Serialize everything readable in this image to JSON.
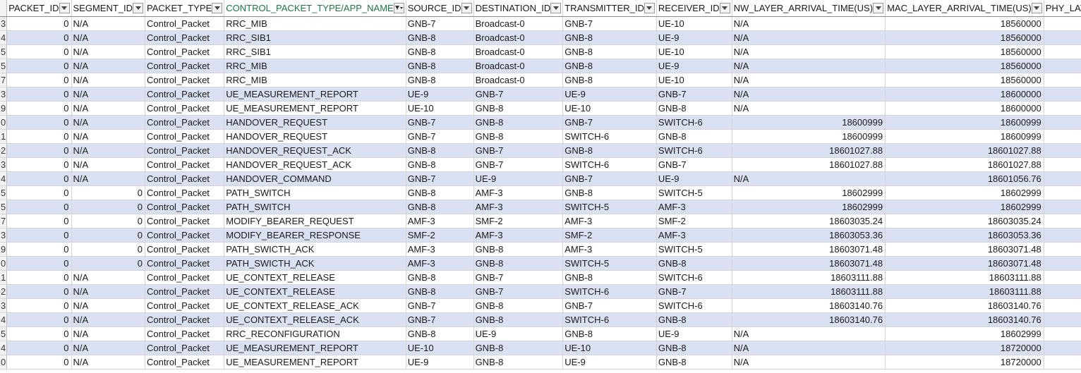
{
  "columns": [
    {
      "key": "PACKET_ID",
      "label": "PACKET_ID",
      "filtered": false
    },
    {
      "key": "SEGMENT_ID",
      "label": "SEGMENT_ID",
      "filtered": false
    },
    {
      "key": "PACKET_TYPE",
      "label": "PACKET_TYPE",
      "filtered": false
    },
    {
      "key": "CONTROL_PACKET_TYPE",
      "label": "CONTROL_PACKET_TYPE/APP_NAME",
      "filtered": true
    },
    {
      "key": "SOURCE_ID",
      "label": "SOURCE_ID",
      "filtered": false
    },
    {
      "key": "DESTINATION_ID",
      "label": "DESTINATION_ID",
      "filtered": false
    },
    {
      "key": "TRANSMITTER_ID",
      "label": "TRANSMITTER_ID",
      "filtered": false
    },
    {
      "key": "RECEIVER_ID",
      "label": "RECEIVER_ID",
      "filtered": false
    },
    {
      "key": "NW_LAYER_ARRIVAL",
      "label": "NW_LAYER_ARRIVAL_TIME(US)",
      "filtered": false
    },
    {
      "key": "MAC_LAYER_ARRIVAL",
      "label": "MAC_LAYER_ARRIVAL_TIME(US)",
      "filtered": false
    },
    {
      "key": "PHY_LAYER_ARR",
      "label": "PHY_LAYER_ARR",
      "filtered": false
    }
  ],
  "rows": [
    {
      "rh": "3",
      "c": [
        "0",
        "N/A",
        "Control_Packet",
        "RRC_MIB",
        "GNB-7",
        "Broadcast-0",
        "GNB-7",
        "UE-10",
        "N/A",
        "18560000",
        ""
      ]
    },
    {
      "rh": "4",
      "c": [
        "0",
        "N/A",
        "Control_Packet",
        "RRC_SIB1",
        "GNB-8",
        "Broadcast-0",
        "GNB-8",
        "UE-9",
        "N/A",
        "18560000",
        ""
      ]
    },
    {
      "rh": "5",
      "c": [
        "0",
        "N/A",
        "Control_Packet",
        "RRC_SIB1",
        "GNB-8",
        "Broadcast-0",
        "GNB-8",
        "UE-10",
        "N/A",
        "18560000",
        ""
      ]
    },
    {
      "rh": "5",
      "c": [
        "0",
        "N/A",
        "Control_Packet",
        "RRC_MIB",
        "GNB-8",
        "Broadcast-0",
        "GNB-8",
        "UE-9",
        "N/A",
        "18560000",
        ""
      ]
    },
    {
      "rh": "7",
      "c": [
        "0",
        "N/A",
        "Control_Packet",
        "RRC_MIB",
        "GNB-8",
        "Broadcast-0",
        "GNB-8",
        "UE-10",
        "N/A",
        "18560000",
        ""
      ]
    },
    {
      "rh": "3",
      "c": [
        "0",
        "N/A",
        "Control_Packet",
        "UE_MEASUREMENT_REPORT",
        "UE-9",
        "GNB-7",
        "UE-9",
        "GNB-7",
        "N/A",
        "18600000",
        ""
      ]
    },
    {
      "rh": "9",
      "c": [
        "0",
        "N/A",
        "Control_Packet",
        "UE_MEASUREMENT_REPORT",
        "UE-10",
        "GNB-8",
        "UE-10",
        "GNB-8",
        "N/A",
        "18600000",
        ""
      ]
    },
    {
      "rh": "0",
      "c": [
        "0",
        "N/A",
        "Control_Packet",
        "HANDOVER_REQUEST",
        "GNB-7",
        "GNB-8",
        "GNB-7",
        "SWITCH-6",
        "18600999",
        "18600999",
        ""
      ]
    },
    {
      "rh": "1",
      "c": [
        "0",
        "N/A",
        "Control_Packet",
        "HANDOVER_REQUEST",
        "GNB-7",
        "GNB-8",
        "SWITCH-6",
        "GNB-8",
        "18600999",
        "18600999",
        ""
      ]
    },
    {
      "rh": "2",
      "c": [
        "0",
        "N/A",
        "Control_Packet",
        "HANDOVER_REQUEST_ACK",
        "GNB-8",
        "GNB-7",
        "GNB-8",
        "SWITCH-6",
        "18601027.88",
        "18601027.88",
        ""
      ]
    },
    {
      "rh": "3",
      "c": [
        "0",
        "N/A",
        "Control_Packet",
        "HANDOVER_REQUEST_ACK",
        "GNB-8",
        "GNB-7",
        "SWITCH-6",
        "GNB-7",
        "18601027.88",
        "18601027.88",
        ""
      ]
    },
    {
      "rh": "4",
      "c": [
        "0",
        "N/A",
        "Control_Packet",
        "HANDOVER_COMMAND",
        "GNB-7",
        "UE-9",
        "GNB-7",
        "UE-9",
        "N/A",
        "18601056.76",
        ""
      ]
    },
    {
      "rh": "5",
      "c": [
        "0",
        "0",
        "Control_Packet",
        "PATH_SWITCH",
        "GNB-8",
        "AMF-3",
        "GNB-8",
        "SWITCH-5",
        "18602999",
        "18602999",
        ""
      ]
    },
    {
      "rh": "5",
      "c": [
        "0",
        "0",
        "Control_Packet",
        "PATH_SWITCH",
        "GNB-8",
        "AMF-3",
        "SWITCH-5",
        "AMF-3",
        "18602999",
        "18602999",
        ""
      ]
    },
    {
      "rh": "7",
      "c": [
        "0",
        "0",
        "Control_Packet",
        "MODIFY_BEARER_REQUEST",
        "AMF-3",
        "SMF-2",
        "AMF-3",
        "SMF-2",
        "18603035.24",
        "18603035.24",
        ""
      ]
    },
    {
      "rh": "3",
      "c": [
        "0",
        "0",
        "Control_Packet",
        "MODIFY_BEARER_RESPONSE",
        "SMF-2",
        "AMF-3",
        "SMF-2",
        "AMF-3",
        "18603053.36",
        "18603053.36",
        ""
      ]
    },
    {
      "rh": "9",
      "c": [
        "0",
        "0",
        "Control_Packet",
        "PATH_SWICTH_ACK",
        "AMF-3",
        "GNB-8",
        "AMF-3",
        "SWITCH-5",
        "18603071.48",
        "18603071.48",
        ""
      ]
    },
    {
      "rh": "0",
      "c": [
        "0",
        "0",
        "Control_Packet",
        "PATH_SWICTH_ACK",
        "AMF-3",
        "GNB-8",
        "SWITCH-5",
        "GNB-8",
        "18603071.48",
        "18603071.48",
        ""
      ]
    },
    {
      "rh": "1",
      "c": [
        "0",
        "N/A",
        "Control_Packet",
        "UE_CONTEXT_RELEASE",
        "GNB-8",
        "GNB-7",
        "GNB-8",
        "SWITCH-6",
        "18603111.88",
        "18603111.88",
        ""
      ]
    },
    {
      "rh": "2",
      "c": [
        "0",
        "N/A",
        "Control_Packet",
        "UE_CONTEXT_RELEASE",
        "GNB-8",
        "GNB-7",
        "SWITCH-6",
        "GNB-7",
        "18603111.88",
        "18603111.88",
        ""
      ]
    },
    {
      "rh": "3",
      "c": [
        "0",
        "N/A",
        "Control_Packet",
        "UE_CONTEXT_RELEASE_ACK",
        "GNB-7",
        "GNB-8",
        "GNB-7",
        "SWITCH-6",
        "18603140.76",
        "18603140.76",
        ""
      ]
    },
    {
      "rh": "4",
      "c": [
        "0",
        "N/A",
        "Control_Packet",
        "UE_CONTEXT_RELEASE_ACK",
        "GNB-7",
        "GNB-8",
        "SWITCH-6",
        "GNB-8",
        "18603140.76",
        "18603140.76",
        ""
      ]
    },
    {
      "rh": "5",
      "c": [
        "0",
        "N/A",
        "Control_Packet",
        "RRC_RECONFIGURATION",
        "GNB-8",
        "UE-9",
        "GNB-8",
        "UE-9",
        "N/A",
        "18602999",
        ""
      ]
    },
    {
      "rh": "4",
      "c": [
        "0",
        "N/A",
        "Control_Packet",
        "UE_MEASUREMENT_REPORT",
        "UE-10",
        "GNB-8",
        "UE-10",
        "GNB-8",
        "N/A",
        "18720000",
        ""
      ]
    },
    {
      "rh": "0",
      "c": [
        "0",
        "N/A",
        "Control_Packet",
        "UE_MEASUREMENT_REPORT",
        "UE-9",
        "GNB-8",
        "UE-9",
        "GNB-8",
        "N/A",
        "18720000",
        ""
      ]
    }
  ],
  "colors": {
    "band": "#d9e1f2",
    "filtered_header": "#217346",
    "grid": "#d4d4d4"
  }
}
